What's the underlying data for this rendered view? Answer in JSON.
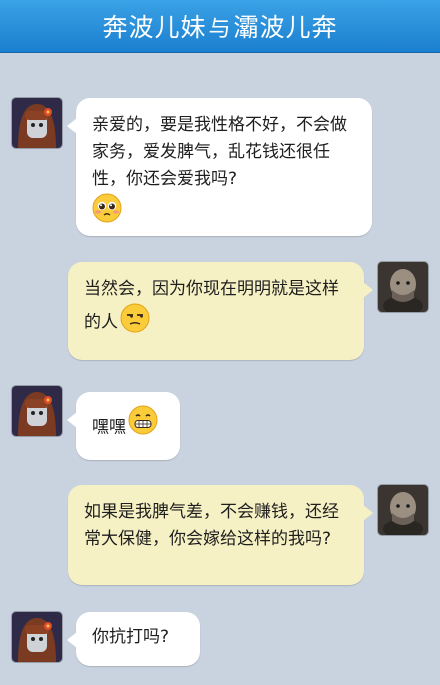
{
  "header": {
    "title_part1": "奔波儿妹",
    "title_join": "与",
    "title_part2": "灞波儿奔"
  },
  "messages": [
    {
      "sender": "female",
      "text": "亲爱的，要是我性格不好，不会做家务，爱发脾气，乱花钱还很任性，你还会爱我吗?",
      "emoji": "pleading-face-icon"
    },
    {
      "sender": "male",
      "text": "当然会，因为你现在明明就是这样的人",
      "emoji": "unamused-face-icon"
    },
    {
      "sender": "female",
      "text": "嘿嘿",
      "emoji": "grimacing-face-icon"
    },
    {
      "sender": "male",
      "text": "如果是我脾气差，不会赚钱，还经常大保健，你会嫁给这样的我吗?"
    },
    {
      "sender": "female",
      "text": "你抗打吗?"
    }
  ],
  "colors": {
    "background": "#c9d2df",
    "title_bar": "#1b7fcf",
    "bubble_left": "#ffffff",
    "bubble_right": "#f6f1c4"
  }
}
